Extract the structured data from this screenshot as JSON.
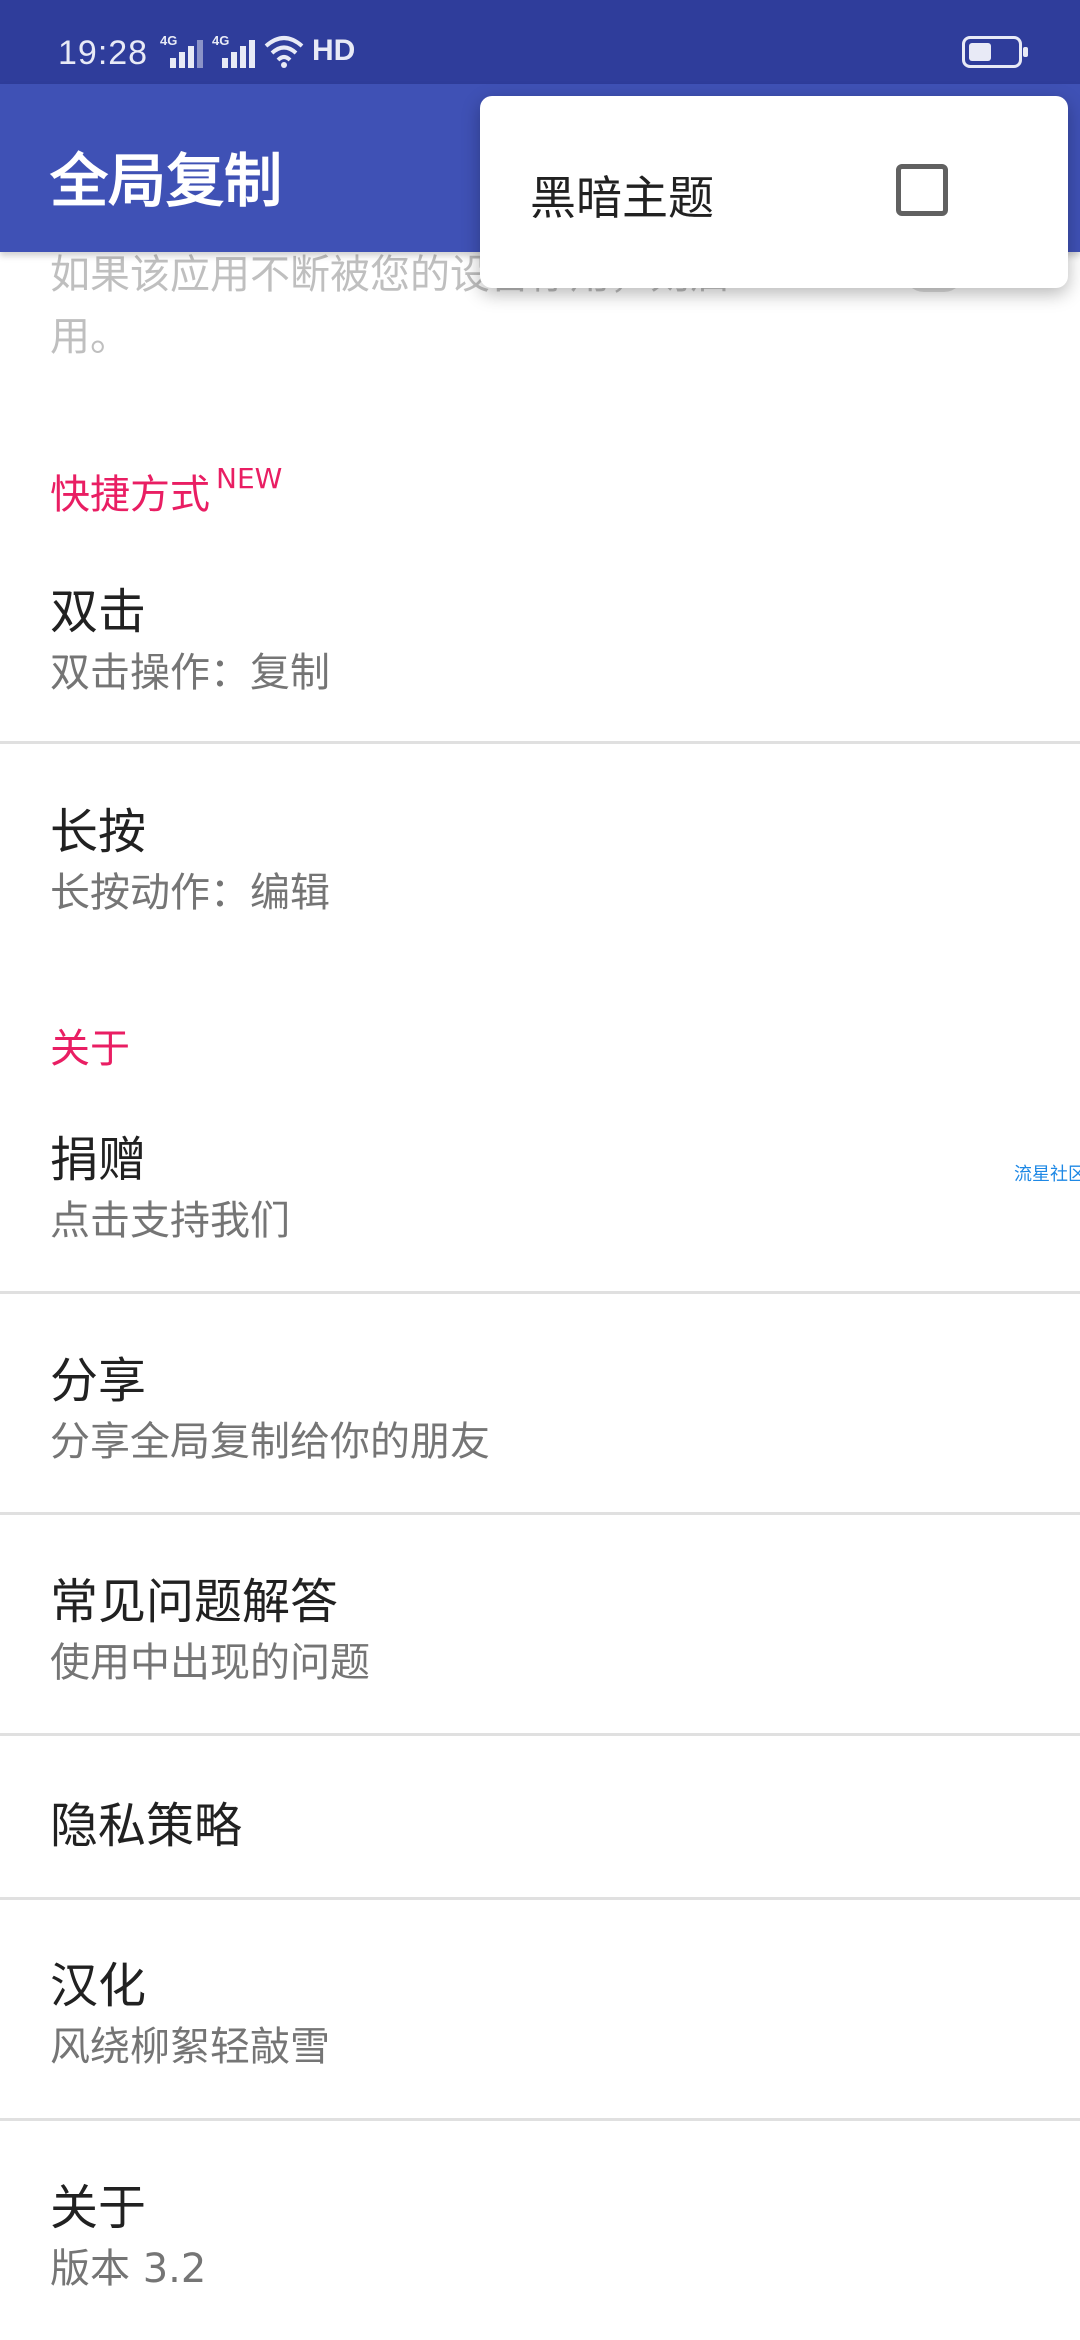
{
  "status_bar": {
    "time": "19:28",
    "sim1_label": "4G",
    "sim2_label": "4G",
    "hd_label": "HD",
    "colors": {
      "background": "#2f3d9b"
    }
  },
  "app_bar": {
    "title": "全局复制",
    "colors": {
      "background": "#3f51b5"
    }
  },
  "overflow_menu": {
    "items": [
      {
        "label": "黑暗主题",
        "checked": false
      }
    ]
  },
  "partial_row": {
    "text": "如果该应用不断被您的设备停用，则启用。",
    "toggle_on": false
  },
  "sections": {
    "shortcuts": {
      "header": "快捷方式",
      "badge": "NEW",
      "items": [
        {
          "title": "双击",
          "summary": "双击操作：复制"
        },
        {
          "title": "长按",
          "summary": "长按动作：编辑"
        }
      ]
    },
    "about": {
      "header": "关于",
      "items": [
        {
          "title": "捐赠",
          "summary": "点击支持我们"
        },
        {
          "title": "分享",
          "summary": "分享全局复制给你的朋友"
        },
        {
          "title": "常见问题解答",
          "summary": "使用中出现的问题"
        },
        {
          "title": "隐私策略"
        },
        {
          "title": "汉化",
          "summary": "风绕柳絮轻敲雪"
        },
        {
          "title": "关于",
          "summary": "版本 3.2"
        }
      ]
    }
  },
  "watermark": "流星社区",
  "colors": {
    "accent": "#e91e63",
    "primary": "#3f51b5",
    "primary_dark": "#2f3d9b",
    "watermark": "#1e88e5"
  }
}
